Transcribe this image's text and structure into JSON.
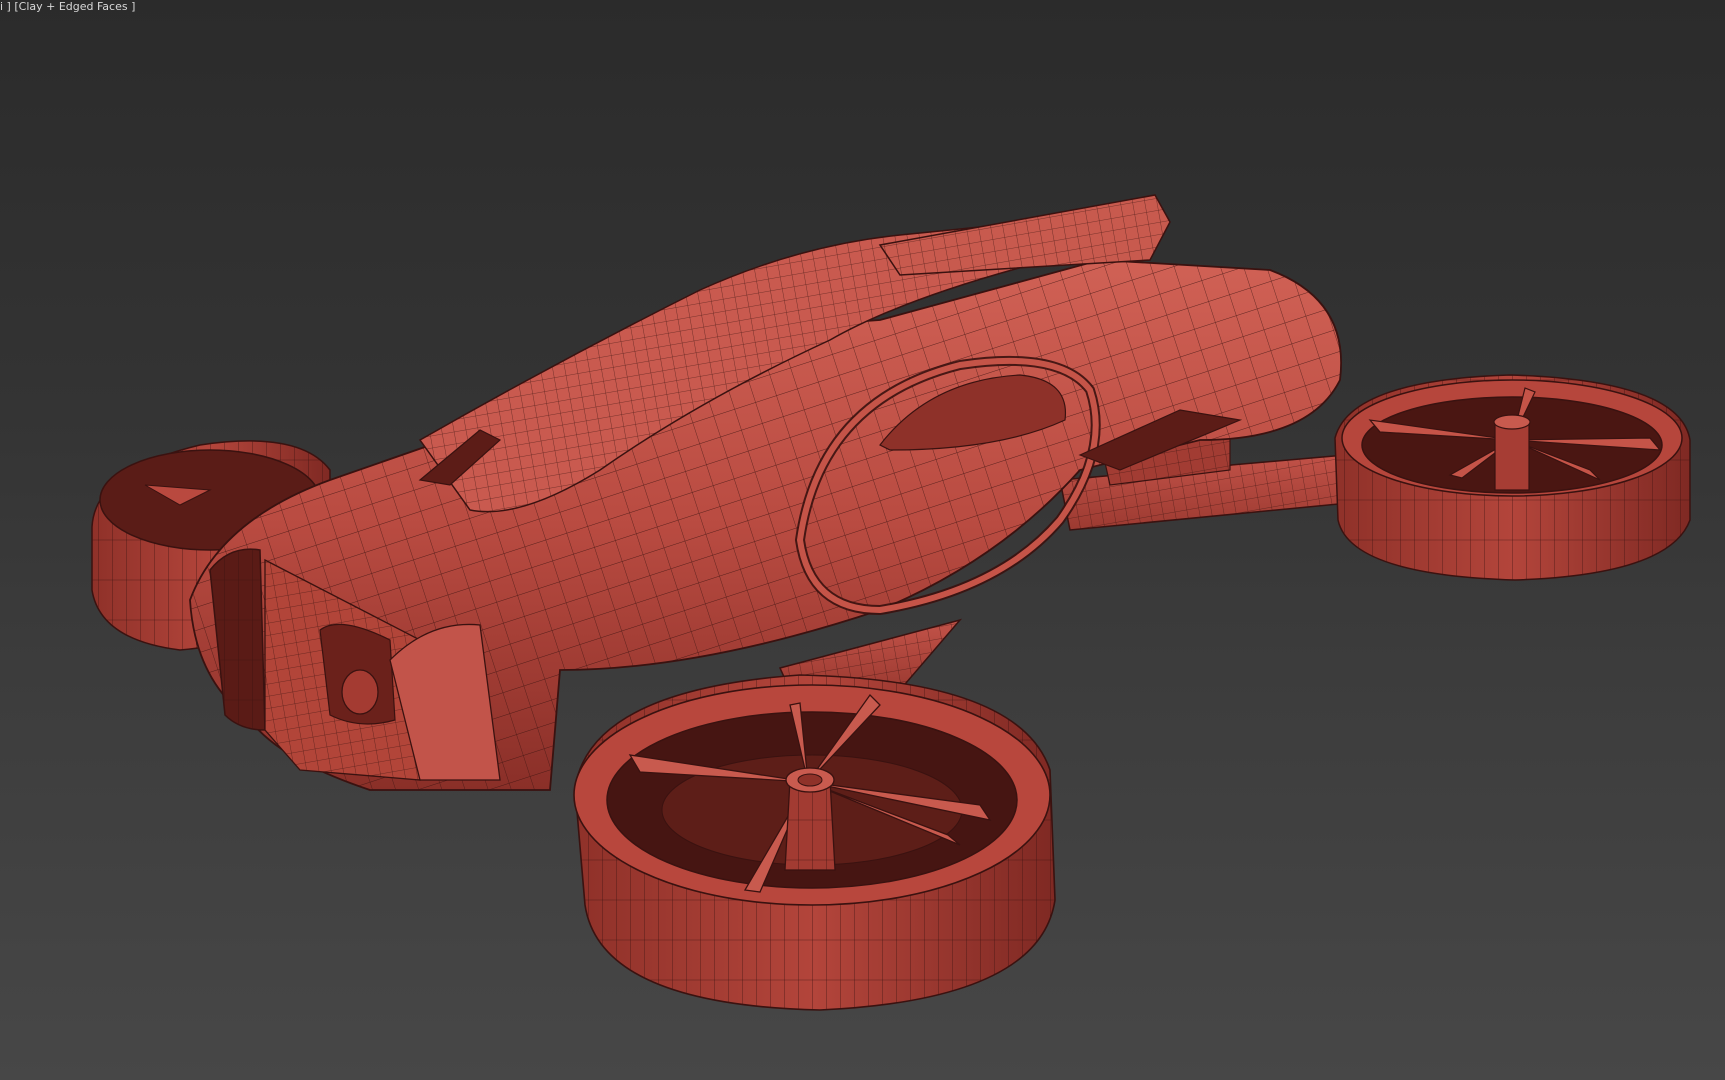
{
  "viewport": {
    "label_prefix": "i ] ",
    "render_mode": "[Clay + Edged Faces ]"
  },
  "colors": {
    "background_top": "#2b2b2b",
    "background_bottom": "#474747",
    "clay_base": "#b84a40",
    "clay_light": "#cf5c50",
    "clay_dark": "#7a2a24",
    "edge": "#3a1210"
  },
  "scene": {
    "object": "flying-car-drone-model"
  }
}
